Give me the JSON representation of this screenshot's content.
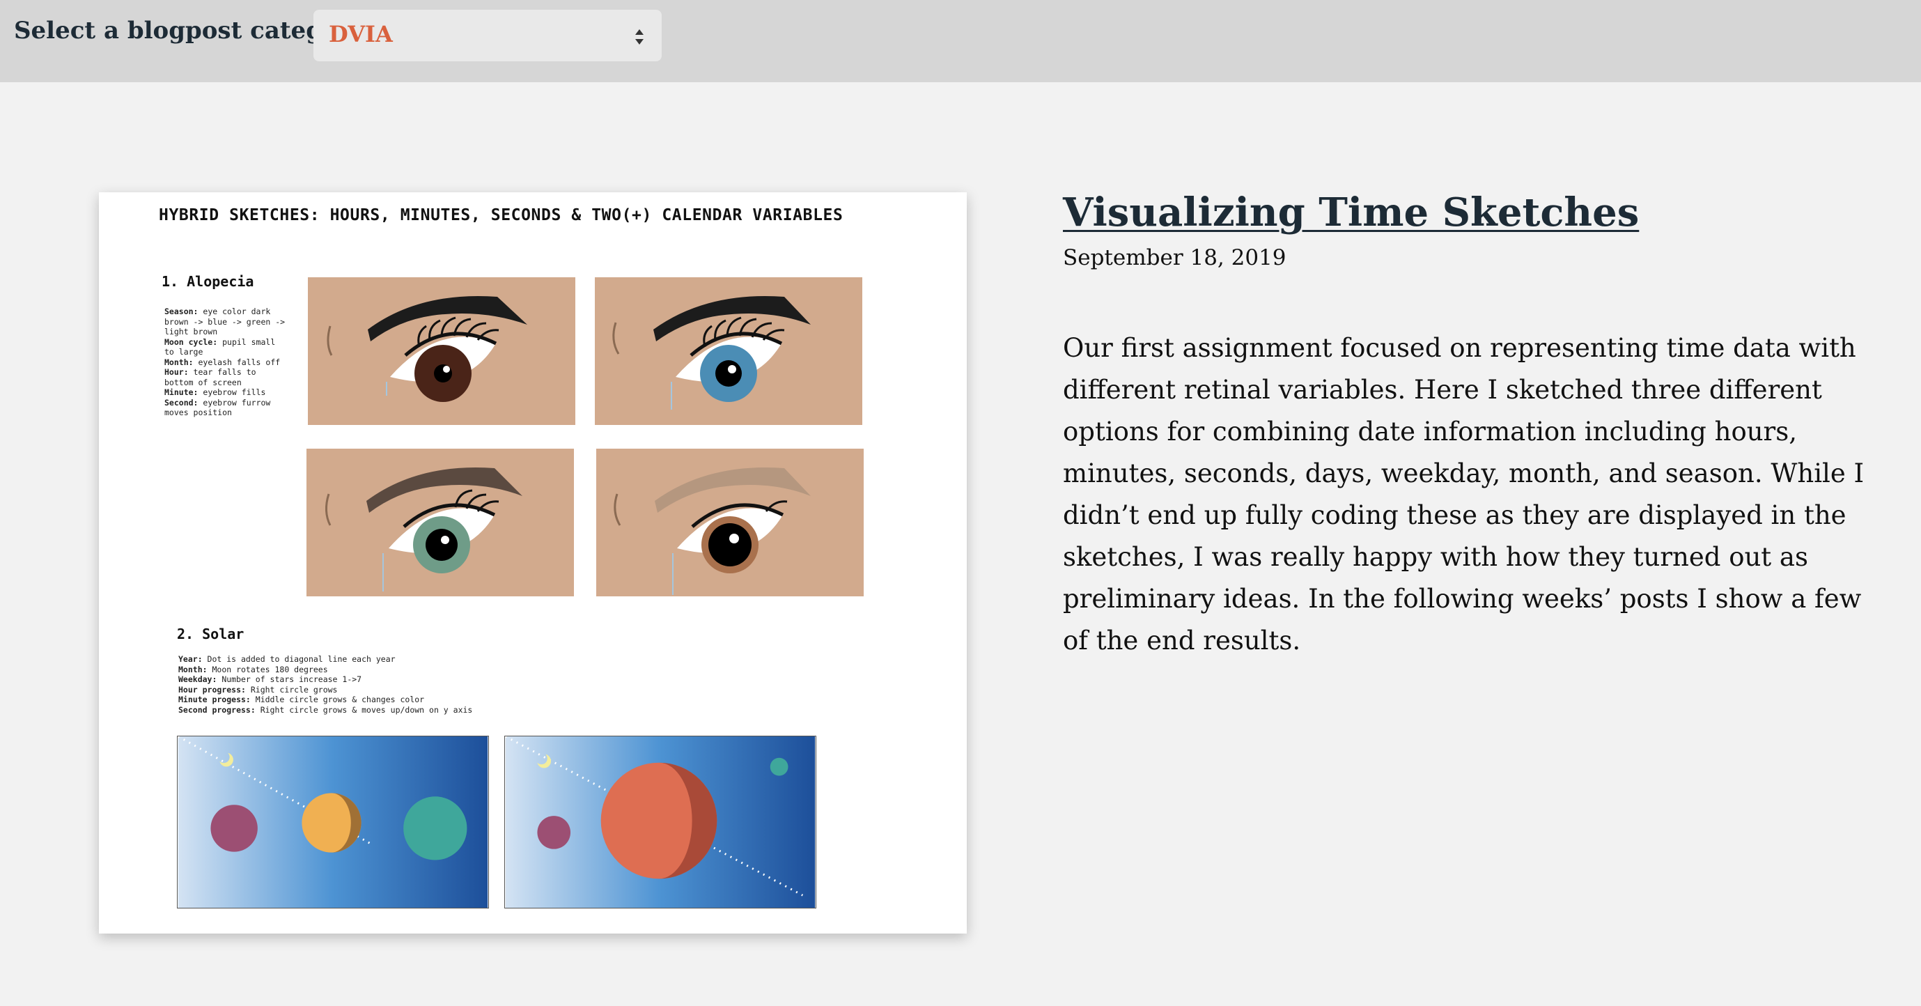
{
  "filter": {
    "label": "Select a blogpost category:",
    "selected": "DVIA"
  },
  "figure": {
    "title": "HYBRID SKETCHES: HOURS, MINUTES, SECONDS & TWO(+) CALENDAR VARIABLES",
    "alopecia": {
      "heading": "1. Alopecia",
      "notes": [
        {
          "key": "Season:",
          "text": " eye color dark"
        },
        {
          "key": "",
          "text": "brown -> blue -> green ->"
        },
        {
          "key": "",
          "text": "light brown"
        },
        {
          "key": "Moon cycle:",
          "text": " pupil small"
        },
        {
          "key": "",
          "text": "to large"
        },
        {
          "key": "Month:",
          "text": " eyelash falls off"
        },
        {
          "key": "Hour:",
          "text": " tear falls to"
        },
        {
          "key": "",
          "text": "bottom of screen"
        },
        {
          "key": "Minute:",
          "text": " eyebrow fills"
        },
        {
          "key": "Second:",
          "text": " eyebrow furrow"
        },
        {
          "key": "",
          "text": "moves position"
        }
      ]
    },
    "solar": {
      "heading": "2. Solar",
      "notes": [
        {
          "key": "Year:",
          "text": " Dot is added to diagonal line each year"
        },
        {
          "key": "Month:",
          "text": " Moon rotates 180 degrees"
        },
        {
          "key": "Weekday:",
          "text": " Number of stars increase 1->7"
        },
        {
          "key": "Hour progress:",
          "text": " Right circle grows"
        },
        {
          "key": "Minute progess:",
          "text": " Middle circle grows & changes color"
        },
        {
          "key": "Second progress:",
          "text": " Right circle grows & moves up/down on y axis"
        }
      ]
    }
  },
  "post": {
    "title": "Visualizing Time Sketches",
    "date": "September 18, 2019",
    "body": "Our first assignment focused on representing time data with different retinal variables. Here I sketched three different options for combining date information including hours, minutes, seconds, days, weekday, month, and season. While I didn’t end up fully coding these as they are displayed in the sketches, I was really happy with how they turned out as preliminary ideas. In the following weeks’ posts I show a few of the end results."
  },
  "colors": {
    "accent": "#d9613d",
    "topbar": "#d6d6d6",
    "heading": "#1d2b36",
    "skin": "#d2aa8d"
  },
  "icons": {
    "select_arrows": "select-arrows-icon"
  }
}
